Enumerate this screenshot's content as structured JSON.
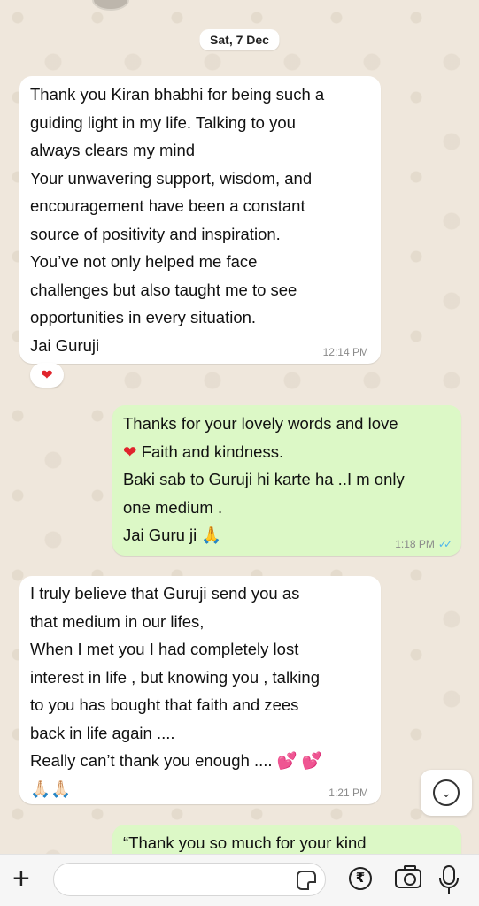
{
  "date_label": "Sat, 7 Dec",
  "messages": [
    {
      "direction": "incoming",
      "lines": [
        "Thank you Kiran bhabhi for being such a",
        "guiding light in my life. Talking to you",
        "always clears my mind",
        "Your unwavering support, wisdom, and",
        "encouragement have been a constant",
        "source of positivity and inspiration.",
        "You’ve not only helped me face",
        "challenges but also taught me to see",
        "opportunities in every situation.",
        "Jai Guruji"
      ],
      "time": "12:14 PM",
      "reaction": "❤"
    },
    {
      "direction": "outgoing",
      "lines": [
        "Thanks for your lovely words and  love",
        "Faith and kindness.",
        "Baki sab to Guruji hi karte ha ..I m only",
        "one medium .",
        "Jai Guru ji 🙏"
      ],
      "line2_emoji": "❤",
      "time": "1:18 PM",
      "status": "read"
    },
    {
      "direction": "incoming",
      "lines": [
        "I truly believe that Guruji send you as",
        "that medium in our lifes,",
        "When I met you I had completely lost",
        "interest in life , but knowing you , talking",
        "to you has bought that faith and zees",
        "back in life again ....",
        "Really can’t thank you enough .... 💕 💕",
        "🙏🏻🙏🏻"
      ],
      "time": "1:21 PM"
    },
    {
      "direction": "outgoing",
      "lines": [
        "“Thank you so much for your kind"
      ]
    }
  ],
  "composer": {
    "placeholder": "",
    "icons": [
      "plus-icon",
      "sticker-icon",
      "rupee-icon",
      "camera-icon",
      "microphone-icon"
    ]
  },
  "colors": {
    "background": "#efe7dc",
    "incoming_bubble": "#ffffff",
    "outgoing_bubble": "#dcf8c6",
    "read_ticks": "#4fb6ec"
  }
}
